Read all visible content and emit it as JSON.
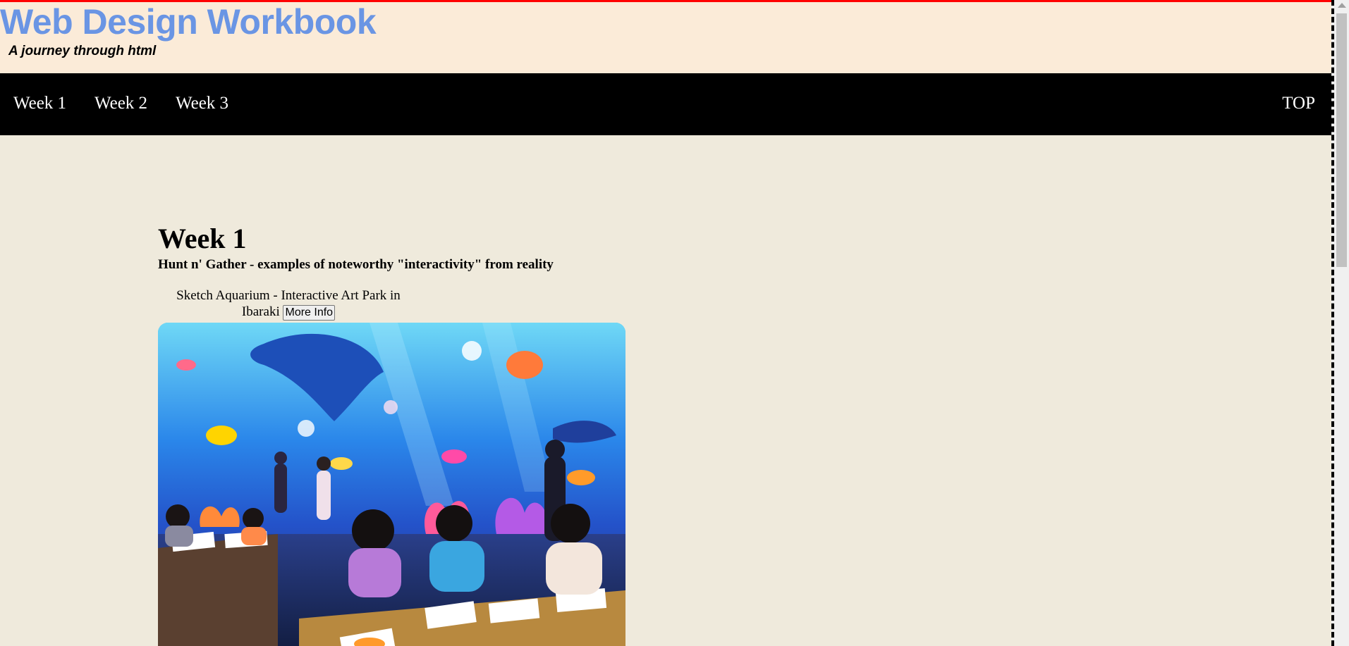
{
  "header": {
    "title": "Web Design Workbook",
    "subtitle": "A journey through html"
  },
  "nav": {
    "items": [
      {
        "label": "Week 1"
      },
      {
        "label": "Week 2"
      },
      {
        "label": "Week 3"
      }
    ],
    "top_label": "TOP"
  },
  "main": {
    "heading": "Week 1",
    "subheading": "Hunt n' Gather - examples of noteworthy \"interactivity\" from reality",
    "card": {
      "caption": "Sketch Aquarium - Interactive Art Park in Ibaraki",
      "button_label": "More Info",
      "image_alt": "children drawing at tables in front of a projected aquarium wall"
    }
  },
  "colors": {
    "top_border": "#ff0000",
    "header_bg": "#fbebd8",
    "title": "#6a95e4",
    "nav_bg": "#000000",
    "page_bg": "#efeadc"
  }
}
